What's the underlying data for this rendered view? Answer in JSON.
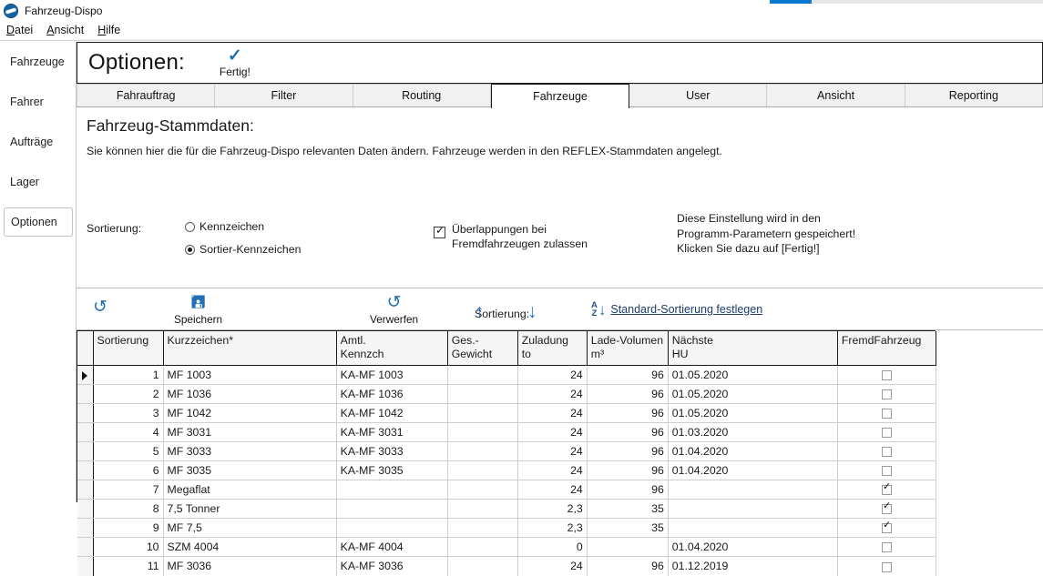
{
  "window": {
    "title": "Fahrzeug-Dispo",
    "app_icon": "app-logo-icon",
    "accent_color": "#0a78d1"
  },
  "menu": {
    "items": [
      {
        "mnemonic": "D",
        "rest": "atei"
      },
      {
        "mnemonic": "A",
        "rest": "nsicht"
      },
      {
        "mnemonic": "H",
        "rest": "ilfe"
      }
    ]
  },
  "sidebar": {
    "items": [
      {
        "label": "Fahrzeuge",
        "selected": false
      },
      {
        "label": "Fahrer",
        "selected": false
      },
      {
        "label": "Aufträge",
        "selected": false
      },
      {
        "label": "Lager",
        "selected": false
      },
      {
        "label": "Optionen",
        "selected": true
      }
    ]
  },
  "header": {
    "title": "Optionen:",
    "done_icon": "checkmark-icon",
    "done_label": "Fertig!"
  },
  "tabs": [
    {
      "label": "Fahrauftrag",
      "active": false
    },
    {
      "label": "Filter",
      "active": false
    },
    {
      "label": "Routing",
      "active": false
    },
    {
      "label": "Fahrzeuge",
      "active": true
    },
    {
      "label": "User",
      "active": false
    },
    {
      "label": "Ansicht",
      "active": false
    },
    {
      "label": "Reporting",
      "active": false
    }
  ],
  "section": {
    "title": "Fahrzeug-Stammdaten:",
    "description": "Sie können hier die für die Fahrzeug-Dispo relevanten Daten ändern. Fahrzeuge werden in den REFLEX-Stammdaten angelegt."
  },
  "settings": {
    "sort_label": "Sortierung:",
    "radio_options": [
      {
        "label": "Kennzeichen",
        "selected": false
      },
      {
        "label": "Sortier-Kennzeichen",
        "selected": true
      }
    ],
    "checkbox": {
      "line1": "Überlappungen bei",
      "line2": "Fremdfahrzeugen zulassen",
      "checked": true
    },
    "note_lines": [
      "Diese Einstellung wird in den",
      "Programm-Parametern gespeichert!",
      "Klicken Sie dazu auf [Fertig!]"
    ]
  },
  "toolbar": {
    "refresh_icon": "refresh-icon",
    "save_icon": "save-disk-icon",
    "save_label": "Speichern",
    "discard_icon": "undo-icon",
    "discard_label": "Verwerfen",
    "sort_label": "Sortierung:",
    "up_icon": "arrow-up-icon",
    "down_icon": "arrow-down-icon",
    "az_icon": "sort-az-icon",
    "az_top": "A",
    "az_bottom": "Z",
    "az_link": "Standard-Sortierung festlegen"
  },
  "grid": {
    "columns": [
      {
        "key": "sortierung",
        "line1": "Sortierung",
        "line2": ""
      },
      {
        "key": "kurzzeichen",
        "line1": "Kurzzeichen*",
        "line2": ""
      },
      {
        "key": "amtl",
        "line1": "Amtl.",
        "line2": "Kennzch"
      },
      {
        "key": "gewicht",
        "line1": "Ges.-",
        "line2": "Gewicht"
      },
      {
        "key": "zuladung",
        "line1": "Zuladung",
        "line2": "to"
      },
      {
        "key": "volumen",
        "line1": "Lade-Volumen",
        "line2": "m³"
      },
      {
        "key": "hu",
        "line1": "Nächste",
        "line2": "HU"
      },
      {
        "key": "fremd",
        "line1": "FremdFahrzeug",
        "line2": ""
      }
    ],
    "rows": [
      {
        "current": true,
        "sortierung": "1",
        "kurzzeichen": "MF 1003",
        "amtl": "KA-MF 1003",
        "gewicht": "",
        "zuladung": "24",
        "volumen": "96",
        "hu": "01.05.2020",
        "fremd": false
      },
      {
        "current": false,
        "sortierung": "2",
        "kurzzeichen": "MF 1036",
        "amtl": "KA-MF 1036",
        "gewicht": "",
        "zuladung": "24",
        "volumen": "96",
        "hu": "01.05.2020",
        "fremd": false
      },
      {
        "current": false,
        "sortierung": "3",
        "kurzzeichen": "MF 1042",
        "amtl": "KA-MF 1042",
        "gewicht": "",
        "zuladung": "24",
        "volumen": "96",
        "hu": "01.05.2020",
        "fremd": false
      },
      {
        "current": false,
        "sortierung": "4",
        "kurzzeichen": "MF 3031",
        "amtl": "KA-MF 3031",
        "gewicht": "",
        "zuladung": "24",
        "volumen": "96",
        "hu": "01.03.2020",
        "fremd": false
      },
      {
        "current": false,
        "sortierung": "5",
        "kurzzeichen": "MF 3033",
        "amtl": "KA-MF 3033",
        "gewicht": "",
        "zuladung": "24",
        "volumen": "96",
        "hu": "01.04.2020",
        "fremd": false
      },
      {
        "current": false,
        "sortierung": "6",
        "kurzzeichen": "MF 3035",
        "amtl": "KA-MF 3035",
        "gewicht": "",
        "zuladung": "24",
        "volumen": "96",
        "hu": "01.04.2020",
        "fremd": false
      },
      {
        "current": false,
        "sortierung": "7",
        "kurzzeichen": "Megaflat",
        "amtl": "",
        "gewicht": "",
        "zuladung": "24",
        "volumen": "96",
        "hu": "",
        "fremd": true
      },
      {
        "current": false,
        "sortierung": "8",
        "kurzzeichen": "7,5 Tonner",
        "amtl": "",
        "gewicht": "",
        "zuladung": "2,3",
        "volumen": "35",
        "hu": "",
        "fremd": true
      },
      {
        "current": false,
        "sortierung": "9",
        "kurzzeichen": "MF 7,5",
        "amtl": "",
        "gewicht": "",
        "zuladung": "2,3",
        "volumen": "35",
        "hu": "",
        "fremd": true
      },
      {
        "current": false,
        "sortierung": "10",
        "kurzzeichen": "SZM 4004",
        "amtl": "KA-MF 4004",
        "gewicht": "",
        "zuladung": "0",
        "volumen": "",
        "hu": "01.04.2020",
        "fremd": false
      },
      {
        "current": false,
        "sortierung": "11",
        "kurzzeichen": "MF 3036",
        "amtl": "KA-MF 3036",
        "gewicht": "",
        "zuladung": "24",
        "volumen": "96",
        "hu": "01.12.2019",
        "fremd": false
      }
    ]
  }
}
